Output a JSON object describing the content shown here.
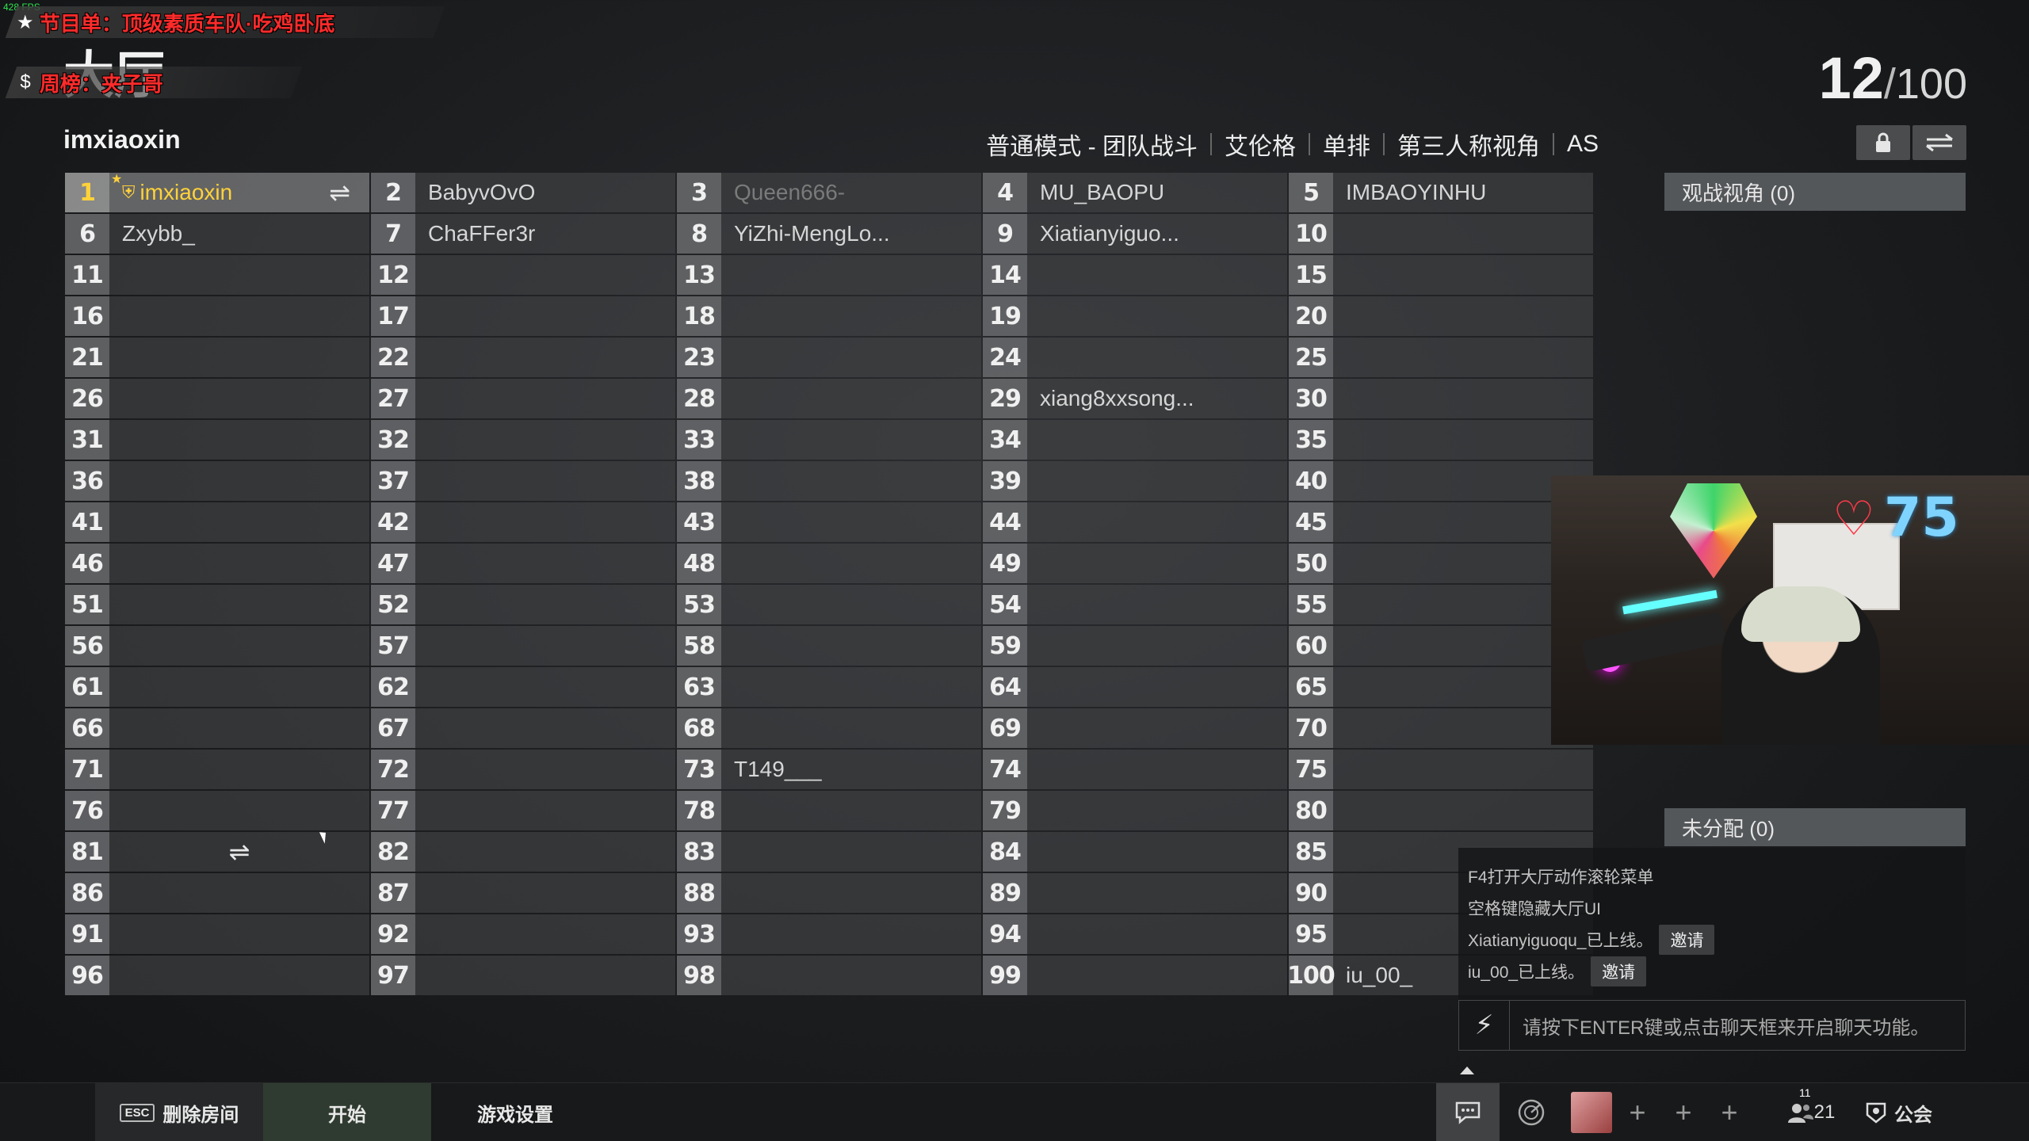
{
  "overlay": {
    "fps": "428 FPS",
    "banner1_text": "节目单：顶级素质车队·吃鸡卧底",
    "banner1_icon": "★",
    "banner2_text": "周榜：夹子哥",
    "banner2_icon": "$",
    "lobby_title": "大厅"
  },
  "header": {
    "username": "imxiaoxin",
    "player_count": "12",
    "player_sep": "/",
    "player_max": "100",
    "mode": "普通模式 - 团队战斗",
    "map": "艾伦格",
    "team_size": "单排",
    "perspective": "第三人称视角",
    "region": "AS",
    "lock_icon": "lock-icon",
    "swap_icon": "swap-icon"
  },
  "slots": [
    {
      "n": "1",
      "name": "imxiaoxin"
    },
    {
      "n": "2",
      "name": "BabyvOvO"
    },
    {
      "n": "3",
      "name": "Queen666-"
    },
    {
      "n": "4",
      "name": "MU_BAOPU"
    },
    {
      "n": "5",
      "name": "IMBAOYINHU"
    },
    {
      "n": "6",
      "name": "Zxybb_"
    },
    {
      "n": "7",
      "name": "ChaFFer3r"
    },
    {
      "n": "8",
      "name": "YiZhi-MengLo..."
    },
    {
      "n": "9",
      "name": "Xiatianyiguo..."
    },
    {
      "n": "10",
      "name": ""
    },
    {
      "n": "11",
      "name": ""
    },
    {
      "n": "12",
      "name": ""
    },
    {
      "n": "13",
      "name": ""
    },
    {
      "n": "14",
      "name": ""
    },
    {
      "n": "15",
      "name": ""
    },
    {
      "n": "16",
      "name": ""
    },
    {
      "n": "17",
      "name": ""
    },
    {
      "n": "18",
      "name": ""
    },
    {
      "n": "19",
      "name": ""
    },
    {
      "n": "20",
      "name": ""
    },
    {
      "n": "21",
      "name": ""
    },
    {
      "n": "22",
      "name": ""
    },
    {
      "n": "23",
      "name": ""
    },
    {
      "n": "24",
      "name": ""
    },
    {
      "n": "25",
      "name": ""
    },
    {
      "n": "26",
      "name": ""
    },
    {
      "n": "27",
      "name": ""
    },
    {
      "n": "28",
      "name": ""
    },
    {
      "n": "29",
      "name": "xiang8xxsong..."
    },
    {
      "n": "30",
      "name": ""
    },
    {
      "n": "31",
      "name": ""
    },
    {
      "n": "32",
      "name": ""
    },
    {
      "n": "33",
      "name": ""
    },
    {
      "n": "34",
      "name": ""
    },
    {
      "n": "35",
      "name": ""
    },
    {
      "n": "36",
      "name": ""
    },
    {
      "n": "37",
      "name": ""
    },
    {
      "n": "38",
      "name": ""
    },
    {
      "n": "39",
      "name": ""
    },
    {
      "n": "40",
      "name": ""
    },
    {
      "n": "41",
      "name": ""
    },
    {
      "n": "42",
      "name": ""
    },
    {
      "n": "43",
      "name": ""
    },
    {
      "n": "44",
      "name": ""
    },
    {
      "n": "45",
      "name": ""
    },
    {
      "n": "46",
      "name": ""
    },
    {
      "n": "47",
      "name": ""
    },
    {
      "n": "48",
      "name": ""
    },
    {
      "n": "49",
      "name": ""
    },
    {
      "n": "50",
      "name": ""
    },
    {
      "n": "51",
      "name": ""
    },
    {
      "n": "52",
      "name": ""
    },
    {
      "n": "53",
      "name": ""
    },
    {
      "n": "54",
      "name": ""
    },
    {
      "n": "55",
      "name": ""
    },
    {
      "n": "56",
      "name": ""
    },
    {
      "n": "57",
      "name": ""
    },
    {
      "n": "58",
      "name": ""
    },
    {
      "n": "59",
      "name": ""
    },
    {
      "n": "60",
      "name": ""
    },
    {
      "n": "61",
      "name": ""
    },
    {
      "n": "62",
      "name": ""
    },
    {
      "n": "63",
      "name": ""
    },
    {
      "n": "64",
      "name": ""
    },
    {
      "n": "65",
      "name": ""
    },
    {
      "n": "66",
      "name": ""
    },
    {
      "n": "67",
      "name": ""
    },
    {
      "n": "68",
      "name": ""
    },
    {
      "n": "69",
      "name": ""
    },
    {
      "n": "70",
      "name": ""
    },
    {
      "n": "71",
      "name": ""
    },
    {
      "n": "72",
      "name": ""
    },
    {
      "n": "73",
      "name": "T149___"
    },
    {
      "n": "74",
      "name": ""
    },
    {
      "n": "75",
      "name": ""
    },
    {
      "n": "76",
      "name": ""
    },
    {
      "n": "77",
      "name": ""
    },
    {
      "n": "78",
      "name": ""
    },
    {
      "n": "79",
      "name": ""
    },
    {
      "n": "80",
      "name": ""
    },
    {
      "n": "81",
      "name": ""
    },
    {
      "n": "82",
      "name": ""
    },
    {
      "n": "83",
      "name": ""
    },
    {
      "n": "84",
      "name": ""
    },
    {
      "n": "85",
      "name": ""
    },
    {
      "n": "86",
      "name": ""
    },
    {
      "n": "87",
      "name": ""
    },
    {
      "n": "88",
      "name": ""
    },
    {
      "n": "89",
      "name": ""
    },
    {
      "n": "90",
      "name": ""
    },
    {
      "n": "91",
      "name": ""
    },
    {
      "n": "92",
      "name": ""
    },
    {
      "n": "93",
      "name": ""
    },
    {
      "n": "94",
      "name": ""
    },
    {
      "n": "95",
      "name": ""
    },
    {
      "n": "96",
      "name": ""
    },
    {
      "n": "97",
      "name": ""
    },
    {
      "n": "98",
      "name": ""
    },
    {
      "n": "99",
      "name": ""
    },
    {
      "n": "100",
      "name": "iu_00_"
    }
  ],
  "slot_states": {
    "self_slot": "1",
    "dim_slots": [
      "3"
    ],
    "swap_icon_slots": [
      "1",
      "81"
    ]
  },
  "right_panel": {
    "spectator_header": "观战视角 (0)",
    "unassigned_header": "未分配 (0)"
  },
  "webcam": {
    "like_count": "75",
    "heart_icon": "heart-icon"
  },
  "chat": {
    "lines": [
      {
        "text": "F4打开大厅动作滚轮菜单",
        "button": ""
      },
      {
        "text": "空格键隐藏大厅UI",
        "button": ""
      },
      {
        "text": "Xiatianyiguoqu_已上线。",
        "button": "邀请"
      },
      {
        "text": "iu_00_已上线。",
        "button": "邀请"
      }
    ],
    "input_placeholder": "请按下ENTER键或点击聊天框来开启聊天功能。",
    "bolt_icon": "lightning-icon"
  },
  "bottombar": {
    "esc_key": "ESC",
    "delete_room": "删除房间",
    "start": "开始",
    "game_settings": "游戏设置",
    "friends_badge": "11",
    "friends_count": "21",
    "guild": "公会"
  },
  "colors": {
    "self_highlight": "#ffd23a",
    "banner_text": "#ff2b2b",
    "webcam_count": "#7fd4ff",
    "fps_text": "#2ee84f"
  }
}
